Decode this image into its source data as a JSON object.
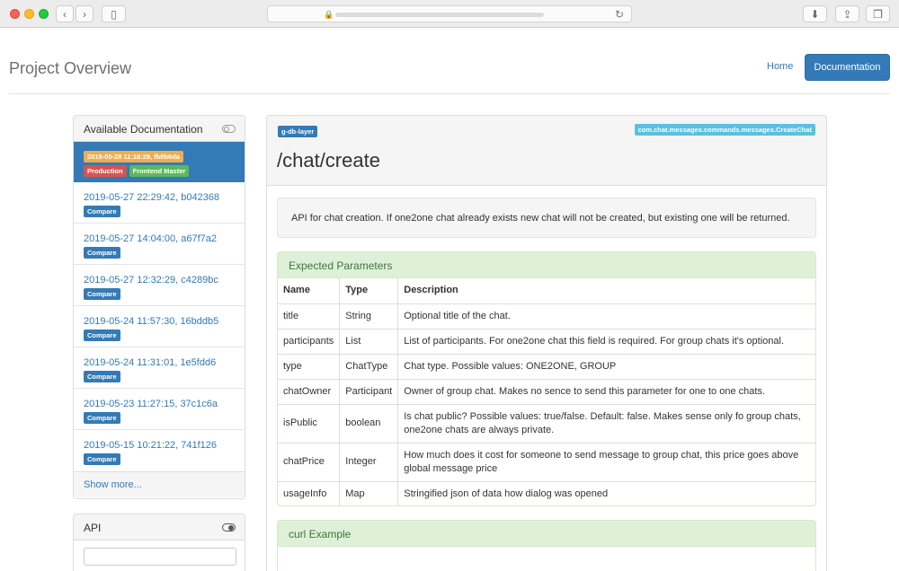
{
  "header": {
    "title": "Project Overview",
    "nav": {
      "home": "Home",
      "documentation": "Documentation"
    }
  },
  "sidebar": {
    "title": "Available Documentation",
    "active": {
      "version": "2019-05-28 11:18:29, fb8b6da",
      "labels": [
        "Production",
        "Frontend Master"
      ]
    },
    "items": [
      {
        "label": "2019-05-27 22:29:42, b042368",
        "action": "Compare"
      },
      {
        "label": "2019-05-27 14:04:00, a67f7a2",
        "action": "Compare"
      },
      {
        "label": "2019-05-27 12:32:29, c4289bc",
        "action": "Compare"
      },
      {
        "label": "2019-05-24 11:57:30, 16bddb5",
        "action": "Compare"
      },
      {
        "label": "2019-05-24 11:31:01, 1e5fdd6",
        "action": "Compare"
      },
      {
        "label": "2019-05-23 11:27:15, 37c1c6a",
        "action": "Compare"
      },
      {
        "label": "2019-05-15 10:21:22, 741f126",
        "action": "Compare"
      }
    ],
    "show_more": "Show more...",
    "api_title": "API"
  },
  "main": {
    "tag_left": "g-db-layer",
    "tag_right": "com.chat.messages.commands.messages.CreateChat",
    "endpoint": "/chat/create",
    "description": "API for chat creation. If one2one chat already exists new chat will not be created, but existing one will be returned.",
    "params_title": "Expected Parameters",
    "columns": [
      "Name",
      "Type",
      "Description"
    ],
    "rows": [
      [
        "title",
        "String",
        "Optional title of the chat."
      ],
      [
        "participants",
        "List",
        "List of participants. For one2one chat this field is required. For group chats it's optional."
      ],
      [
        "type",
        "ChatType",
        "Chat type. Possible values: ONE2ONE, GROUP"
      ],
      [
        "chatOwner",
        "Participant",
        "Owner of group chat. Makes no sence to send this parameter for one to one chats."
      ],
      [
        "isPublic",
        "boolean",
        "Is chat public? Possible values: true/false. Default: false. Makes sense only fo group chats, one2one chats are always private."
      ],
      [
        "chatPrice",
        "Integer",
        "How much does it cost for someone to send message to group chat, this price goes above global message price"
      ],
      [
        "usageInfo",
        "Map",
        "Stringified json of data how dialog was opened"
      ]
    ],
    "curl_title": "curl Example"
  }
}
